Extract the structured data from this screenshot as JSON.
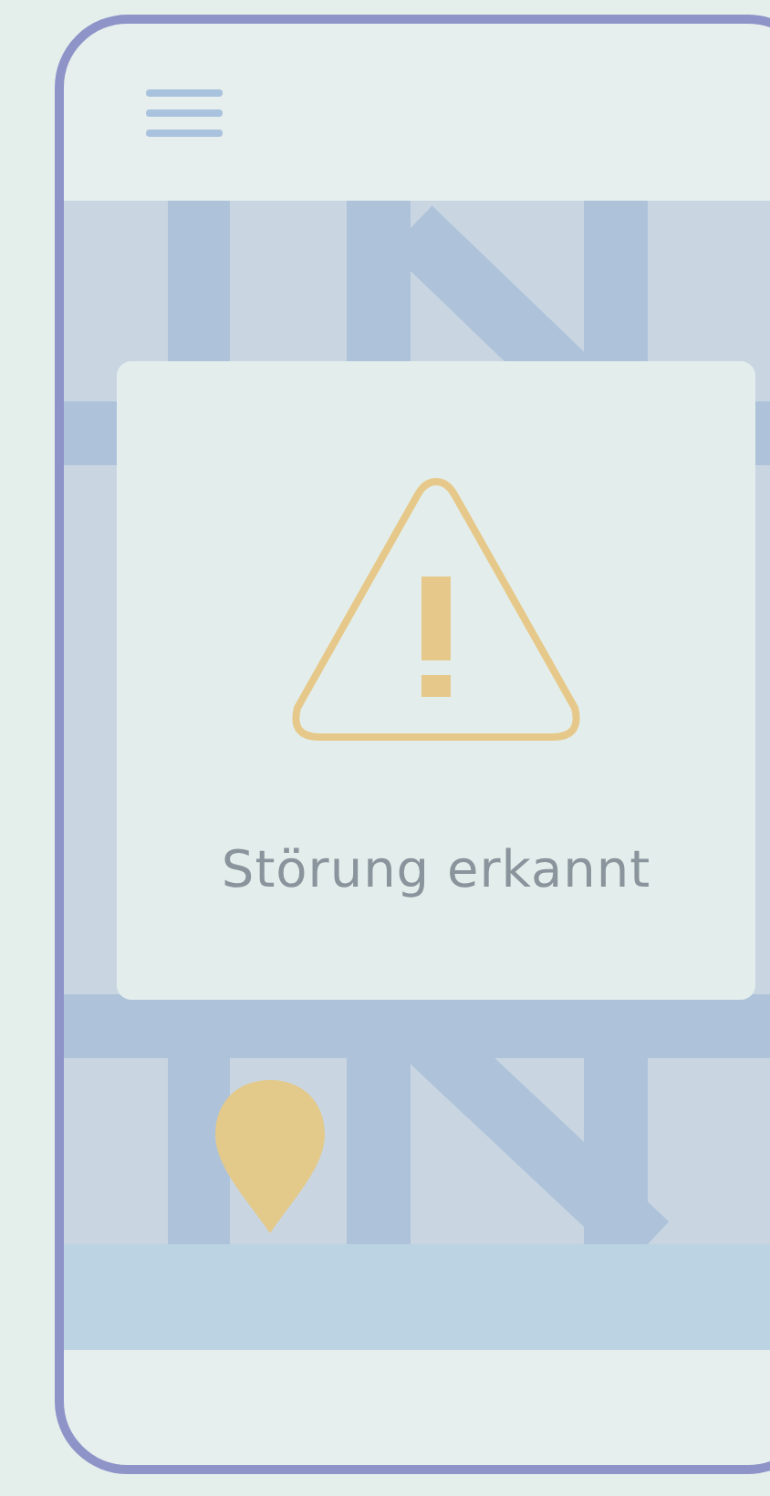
{
  "alert": {
    "message": "Störung erkannt"
  }
}
